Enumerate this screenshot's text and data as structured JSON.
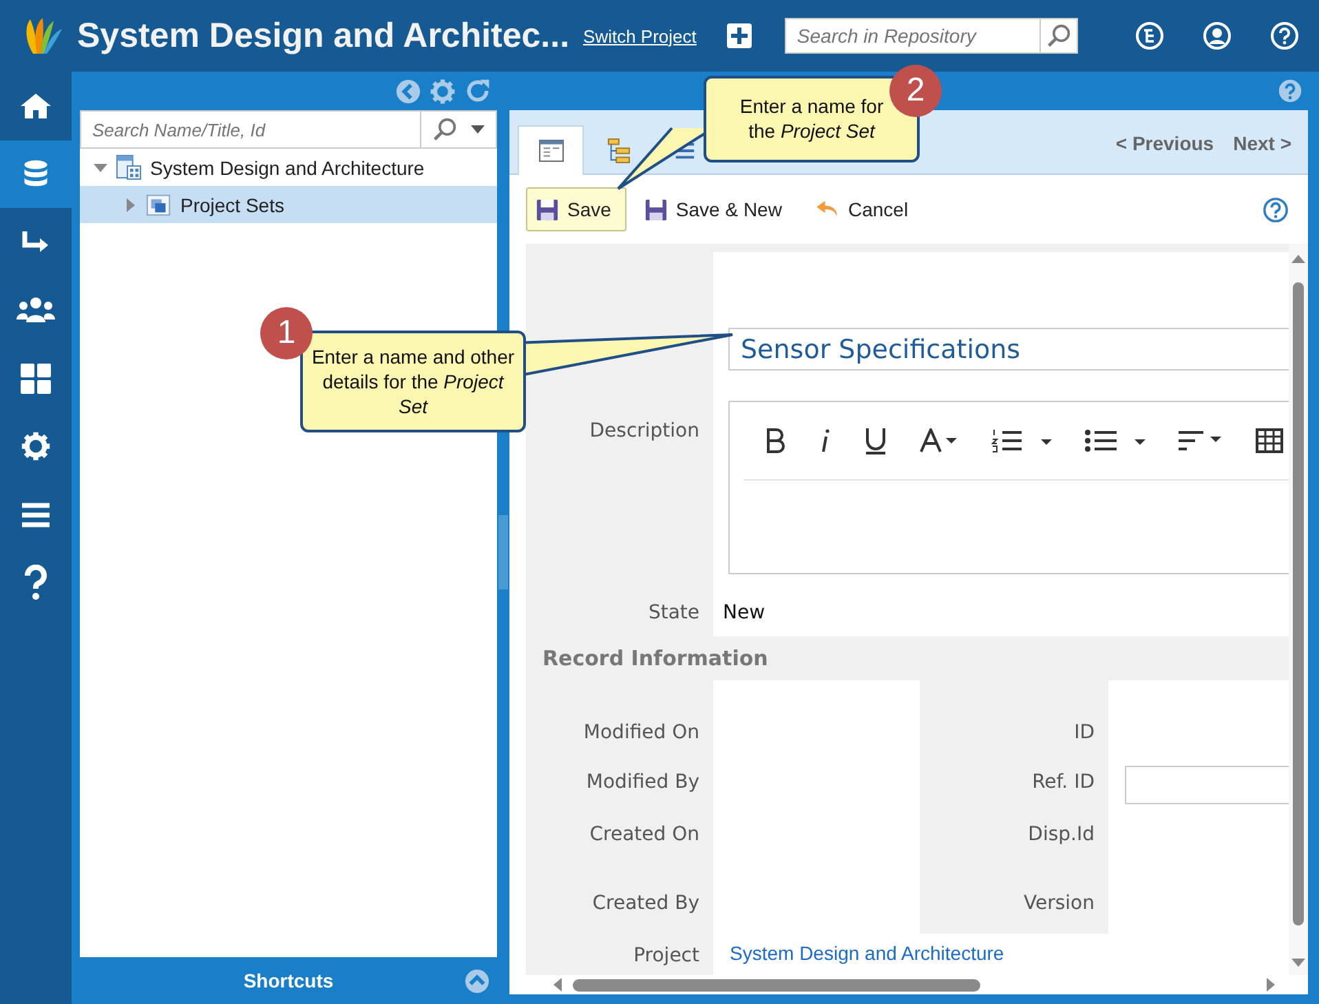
{
  "header": {
    "title": "System Design and Architec...",
    "switch_link": "Switch Project",
    "search": {
      "placeholder": "Search in Repository"
    }
  },
  "rail": [
    {
      "selected": false
    },
    {
      "selected": true
    },
    {
      "selected": false
    },
    {
      "selected": false
    },
    {
      "selected": false
    },
    {
      "selected": false
    },
    {
      "selected": false
    },
    {
      "selected": false
    }
  ],
  "tree_panel": {
    "search": {
      "placeholder": "Search Name/Title, Id"
    },
    "nodes": [
      {
        "label": "System Design and Architecture",
        "expanded": true,
        "selected": false,
        "children": [
          {
            "label": "Project Sets",
            "expanded": false,
            "selected": true
          }
        ]
      }
    ],
    "footer": "Shortcuts"
  },
  "tabs": [
    {
      "selected": true
    },
    {
      "selected": false
    },
    {
      "selected": false
    }
  ],
  "pager": {
    "previous": "< Previous",
    "next": "Next >"
  },
  "actions": [
    {
      "label": "Save",
      "highlighted": true
    },
    {
      "label": "Save & New",
      "highlighted": false
    },
    {
      "label": "Cancel",
      "highlighted": false
    }
  ],
  "form": {
    "name": {
      "value": "Sensor Specifications"
    },
    "description_label": "Description",
    "state_label": "State",
    "state_value": "New",
    "section": "Record Information",
    "fields": [
      {
        "label": "Modified On",
        "kind": "text"
      },
      {
        "label": "ID",
        "kind": "text"
      },
      {
        "label": "Modified By",
        "kind": "text"
      },
      {
        "label": "Ref. ID",
        "kind": "input"
      },
      {
        "label": "Created On",
        "kind": "text"
      },
      {
        "label": "Disp.Id",
        "kind": "text"
      },
      {
        "label": "Created By",
        "kind": "text"
      },
      {
        "label": "Version",
        "kind": "text"
      }
    ],
    "project_label": "Project",
    "project_link": "System Design and Architecture"
  },
  "callouts": [
    {
      "number": "1",
      "text": "Enter a name and other details for the *Project Set*"
    },
    {
      "number": "2",
      "text": "Enter a name for the *Project Set*"
    }
  ]
}
